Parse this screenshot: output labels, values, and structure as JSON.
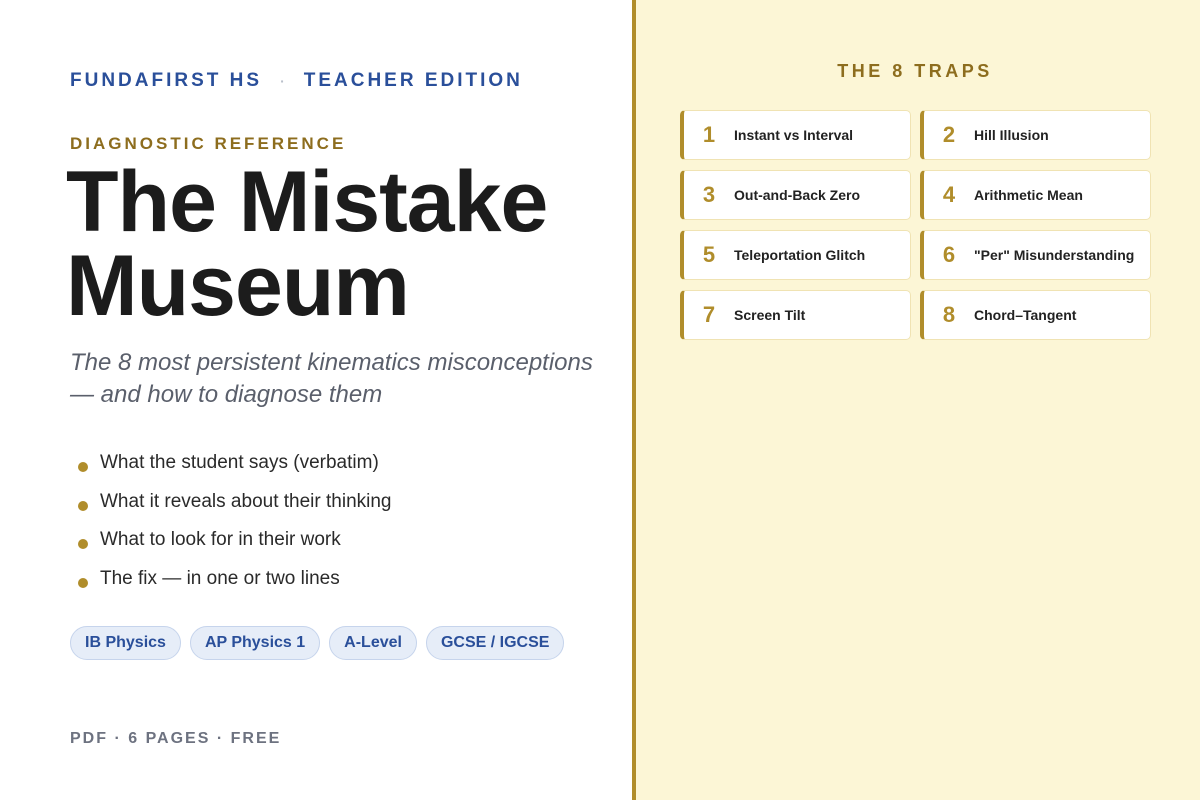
{
  "brand": {
    "name": "FUNDAFIRST HS",
    "separator": "·",
    "edition": "TEACHER EDITION"
  },
  "eyebrow": "DIAGNOSTIC REFERENCE",
  "title": "The Mistake Museum",
  "subtitle": "The 8 most persistent kinematics misconceptions — and how to diagnose them",
  "bullets": [
    "What the student says (verbatim)",
    "What it reveals about their thinking",
    "What to look for in their work",
    "The fix — in one or two lines"
  ],
  "tags": [
    "IB Physics",
    "AP Physics 1",
    "A-Level",
    "GCSE / IGCSE"
  ],
  "footer": "PDF · 6 PAGES · FREE",
  "traps": {
    "heading": "THE 8 TRAPS",
    "items": [
      {
        "num": "1",
        "label": "Instant vs Interval"
      },
      {
        "num": "2",
        "label": "Hill Illusion"
      },
      {
        "num": "3",
        "label": "Out-and-Back Zero"
      },
      {
        "num": "4",
        "label": "Arithmetic Mean"
      },
      {
        "num": "5",
        "label": "Teleportation Glitch"
      },
      {
        "num": "6",
        "label": "\"Per\" Misunderstanding"
      },
      {
        "num": "7",
        "label": "Screen Tilt"
      },
      {
        "num": "8",
        "label": "Chord–Tangent"
      }
    ]
  },
  "colors": {
    "accent_gold": "#b08d2b",
    "brand_blue": "#2a4f9a",
    "panel_cream": "#fcf6d6"
  }
}
